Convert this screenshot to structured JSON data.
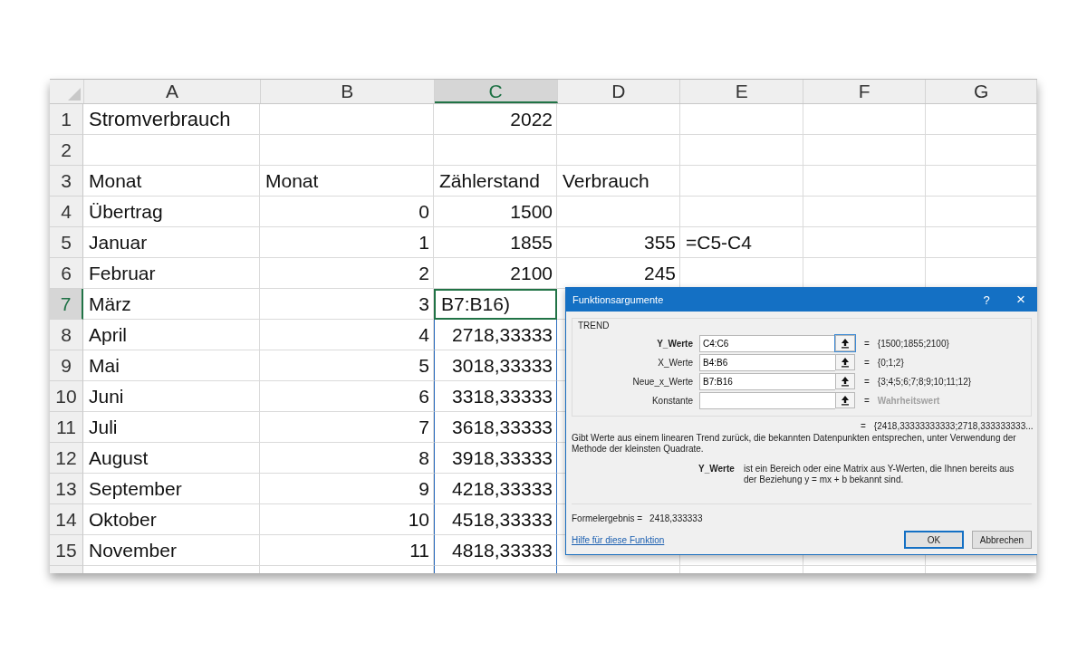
{
  "sheet": {
    "columns": [
      {
        "label": "A",
        "selected": false
      },
      {
        "label": "B",
        "selected": false
      },
      {
        "label": "C",
        "selected": true
      },
      {
        "label": "D",
        "selected": false
      },
      {
        "label": "E",
        "selected": false
      },
      {
        "label": "F",
        "selected": false
      },
      {
        "label": "G",
        "selected": false
      }
    ],
    "rows": [
      {
        "number": "1",
        "selected": false,
        "in_range": false,
        "cells": [
          "Stromverbrauch",
          "",
          "2022",
          "",
          "",
          "",
          ""
        ]
      },
      {
        "number": "2",
        "selected": false,
        "in_range": false,
        "cells": [
          "",
          "",
          "",
          "",
          "",
          "",
          ""
        ]
      },
      {
        "number": "3",
        "selected": false,
        "in_range": false,
        "cells": [
          "Monat",
          "Monat",
          "Zählerstand",
          "Verbrauch",
          "",
          "",
          ""
        ]
      },
      {
        "number": "4",
        "selected": false,
        "in_range": false,
        "cells": [
          "Übertrag",
          "0",
          "1500",
          "",
          "",
          "",
          ""
        ]
      },
      {
        "number": "5",
        "selected": false,
        "in_range": false,
        "cells": [
          "Januar",
          "1",
          "1855",
          "355",
          "=C5-C4",
          "",
          ""
        ]
      },
      {
        "number": "6",
        "selected": false,
        "in_range": false,
        "cells": [
          "Februar",
          "2",
          "2100",
          "245",
          "",
          "",
          ""
        ]
      },
      {
        "number": "7",
        "selected": true,
        "in_range": false,
        "cells": [
          "März",
          "3",
          "B7:B16)",
          "",
          "",
          "",
          ""
        ]
      },
      {
        "number": "8",
        "selected": false,
        "in_range": true,
        "cells": [
          "April",
          "4",
          "2718,33333",
          "",
          "",
          "",
          ""
        ]
      },
      {
        "number": "9",
        "selected": false,
        "in_range": true,
        "cells": [
          "Mai",
          "5",
          "3018,33333",
          "",
          "",
          "",
          ""
        ]
      },
      {
        "number": "10",
        "selected": false,
        "in_range": true,
        "cells": [
          "Juni",
          "6",
          "3318,33333",
          "",
          "",
          "",
          ""
        ]
      },
      {
        "number": "11",
        "selected": false,
        "in_range": true,
        "cells": [
          "Juli",
          "7",
          "3618,33333",
          "",
          "",
          "",
          ""
        ]
      },
      {
        "number": "12",
        "selected": false,
        "in_range": true,
        "cells": [
          "August",
          "8",
          "3918,33333",
          "",
          "",
          "",
          ""
        ]
      },
      {
        "number": "13",
        "selected": false,
        "in_range": true,
        "cells": [
          "September",
          "9",
          "4218,33333",
          "",
          "",
          "",
          ""
        ]
      },
      {
        "number": "14",
        "selected": false,
        "in_range": true,
        "cells": [
          "Oktober",
          "10",
          "4518,33333",
          "",
          "",
          "",
          ""
        ]
      },
      {
        "number": "15",
        "selected": false,
        "in_range": true,
        "cells": [
          "November",
          "11",
          "4818,33333",
          "",
          "",
          "",
          ""
        ]
      }
    ]
  },
  "dialog": {
    "title": "Funktionsargumente",
    "help": "?",
    "close": "×",
    "function_name": "TREND",
    "arguments": [
      {
        "label": "Y_Werte",
        "value": "C4:C6",
        "selected": true,
        "equals": "=",
        "result": "{1500;1855;2100}",
        "kind": "value"
      },
      {
        "label": "X_Werte",
        "value": "B4:B6",
        "selected": false,
        "equals": "=",
        "result": "{0;1;2}",
        "kind": "value"
      },
      {
        "label": "Neue_x_Werte",
        "value": "B7:B16",
        "selected": false,
        "equals": "=",
        "result": "{3;4;5;6;7;8;9;10;11;12}",
        "kind": "value"
      },
      {
        "label": "Konstante",
        "selected": false,
        "equals": "=",
        "result": "Wahrheitswert",
        "kind": "hint"
      }
    ],
    "total_equals": "=",
    "total_result": "{2418,33333333333;2718,333333333...",
    "description": "Gibt Werte aus einem linearen Trend zurück, die bekannten Datenpunkten entsprechen, unter Verwendung der Methode der kleinsten Quadrate.",
    "argument_help_name": "Y_Werte",
    "argument_help_text": "ist ein Bereich oder eine Matrix aus Y-Werten, die Ihnen bereits aus der Beziehung y = mx + b bekannt sind.",
    "formula_result_label": "Formelergebnis =",
    "formula_result_value": "2418,333333",
    "help_link": "Hilfe für diese Funktion",
    "buttons": [
      "OK",
      "Abbrechen"
    ]
  }
}
